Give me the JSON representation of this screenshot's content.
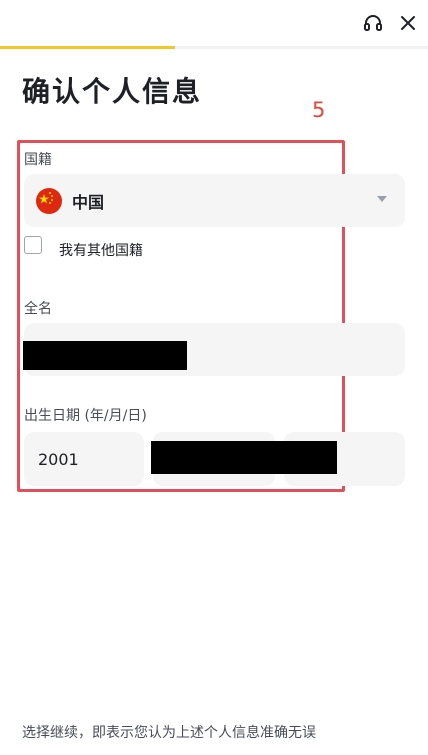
{
  "header": {
    "support_icon": "headset-icon",
    "close_icon": "close-icon",
    "progress_fraction": 0.41
  },
  "page": {
    "title": "确认个人信息",
    "annotation_number": "5"
  },
  "form": {
    "nationality": {
      "label": "国籍",
      "selected_value": "中国",
      "flag_icon": "china-flag-icon"
    },
    "other_nationality": {
      "label": "我有其他国籍",
      "checked": false
    },
    "full_name": {
      "label": "全名",
      "value_redacted": true
    },
    "dob": {
      "label": "出生日期 (年/月/日)",
      "year": "2001",
      "month_redacted": true,
      "day_redacted": true
    }
  },
  "footer": {
    "notice": "选择继续，即表示您认为上述个人信息准确无误"
  },
  "colors": {
    "progress": "#f0c929",
    "annotation": "#e0505a",
    "field_bg": "#f5f5f5",
    "text_primary": "#1e2026",
    "text_secondary": "#474d57"
  }
}
